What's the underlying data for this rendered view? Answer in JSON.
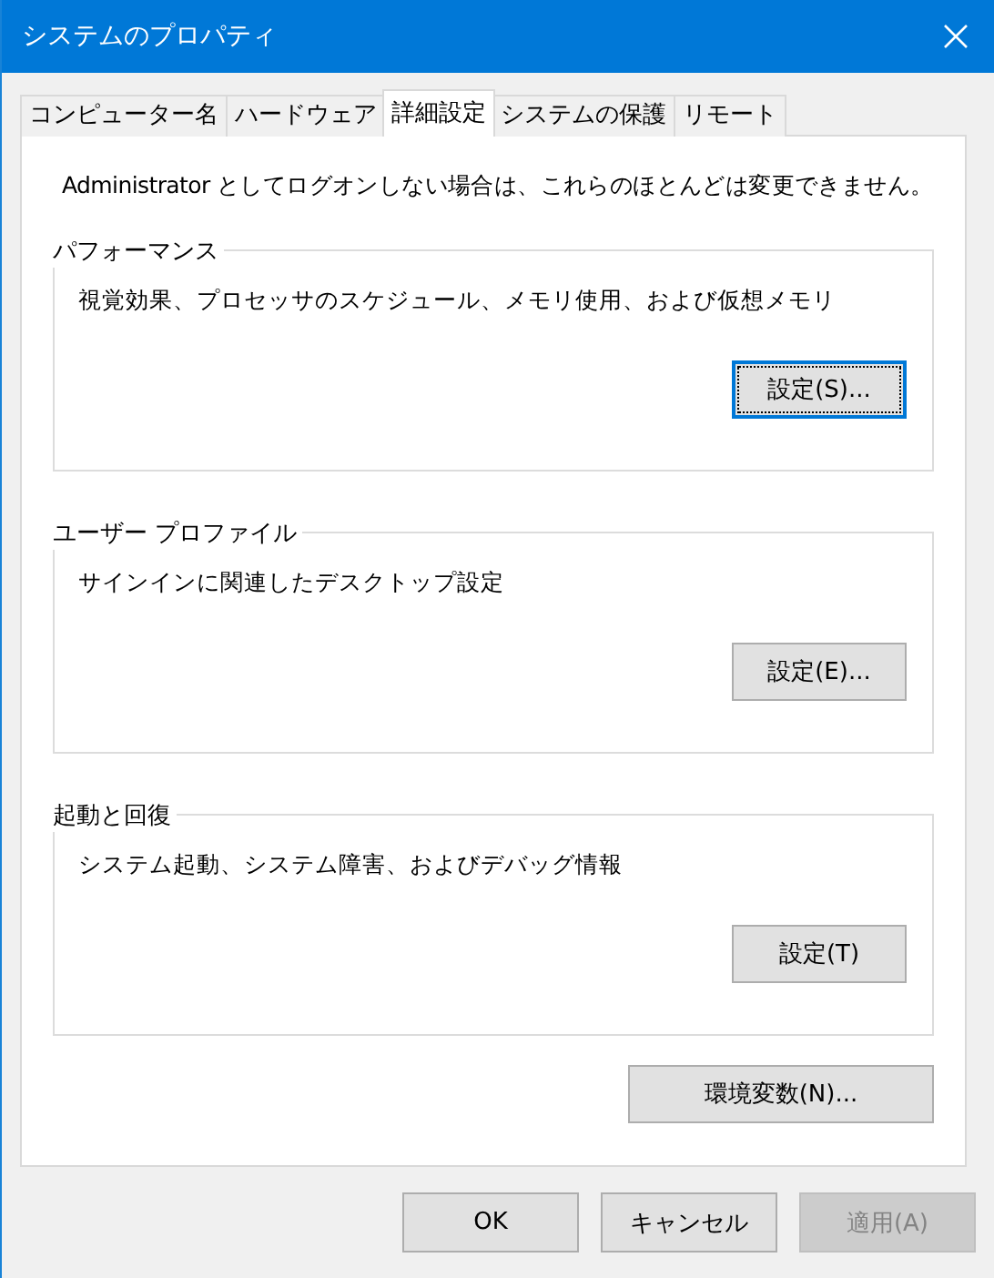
{
  "window": {
    "title": "システムのプロパティ"
  },
  "tabs": [
    {
      "label": "コンピューター名",
      "selected": false
    },
    {
      "label": "ハードウェア",
      "selected": false
    },
    {
      "label": "詳細設定",
      "selected": true
    },
    {
      "label": "システムの保護",
      "selected": false
    },
    {
      "label": "リモート",
      "selected": false
    }
  ],
  "notice": "Administrator としてログオンしない場合は、これらのほとんどは変更できません。",
  "groups": [
    {
      "title": "パフォーマンス",
      "description": "視覚効果、プロセッサのスケジュール、メモリ使用、および仮想メモリ",
      "button": {
        "label": "設定(S)...",
        "focused": true
      }
    },
    {
      "title": "ユーザー プロファイル",
      "description": "サインインに関連したデスクトップ設定",
      "button": {
        "label": "設定(E)...",
        "focused": false
      }
    },
    {
      "title": "起動と回復",
      "description": "システム起動、システム障害、およびデバッグ情報",
      "button": {
        "label": "設定(T)",
        "focused": false
      }
    }
  ],
  "environment_button": {
    "label": "環境変数(N)...",
    "focused": false
  },
  "dialog_buttons": [
    {
      "label": "OK",
      "disabled": false
    },
    {
      "label": "キャンセル",
      "disabled": false
    },
    {
      "label": "適用(A)",
      "disabled": true
    }
  ]
}
